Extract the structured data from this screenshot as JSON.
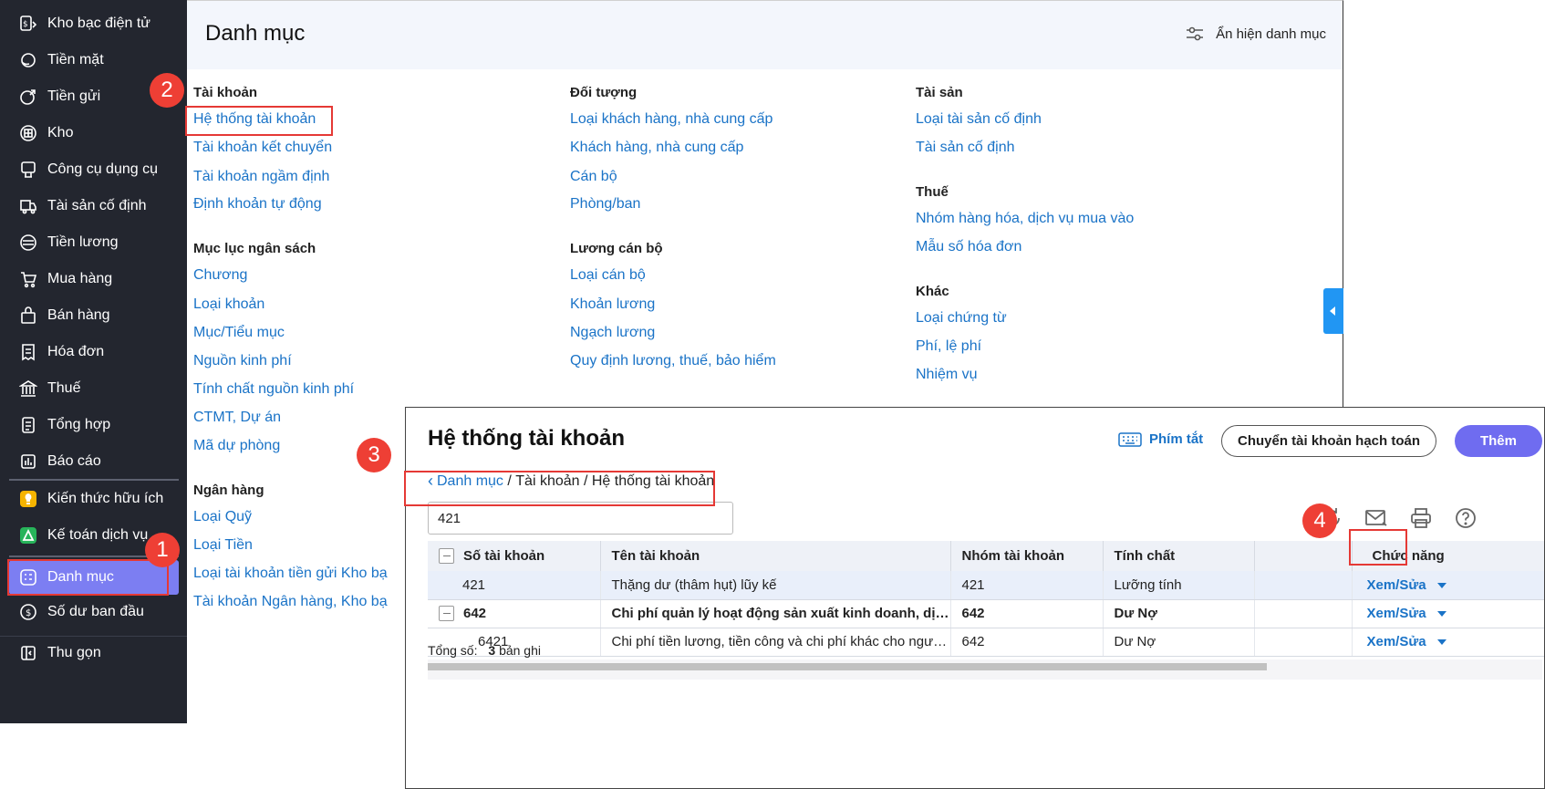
{
  "sidebar": {
    "items": [
      {
        "label": "Kho bạc điện tử",
        "icon": "treasury-icon"
      },
      {
        "label": "Tiền mặt",
        "icon": "cash-icon"
      },
      {
        "label": "Tiền gửi",
        "icon": "deposit-icon"
      },
      {
        "label": "Kho",
        "icon": "warehouse-icon"
      },
      {
        "label": "Công cụ dụng cụ",
        "icon": "tools-icon"
      },
      {
        "label": "Tài sản cố định",
        "icon": "truck-icon"
      },
      {
        "label": "Tiền lương",
        "icon": "salary-icon"
      },
      {
        "label": "Mua hàng",
        "icon": "cart-icon"
      },
      {
        "label": "Bán hàng",
        "icon": "sales-icon"
      },
      {
        "label": "Hóa đơn",
        "icon": "invoice-icon"
      },
      {
        "label": "Thuế",
        "icon": "tax-icon"
      },
      {
        "label": "Tổng hợp",
        "icon": "summary-icon"
      },
      {
        "label": "Báo cáo",
        "icon": "report-icon"
      }
    ],
    "extra": [
      {
        "label": "Kiến thức hữu ích",
        "icon": "lightbulb-icon"
      },
      {
        "label": "Kế toán dịch vụ",
        "icon": "service-icon"
      }
    ],
    "active": {
      "label": "Danh mục",
      "icon": "catalog-icon"
    },
    "opening": {
      "label": "Số dư ban đầu",
      "icon": "opening-balance-icon"
    },
    "collapse": {
      "label": "Thu gọn",
      "icon": "collapse-icon"
    }
  },
  "main": {
    "title": "Danh mục",
    "toggle_label": "Ẩn hiện danh mục",
    "col1": {
      "sections": [
        {
          "title": "Tài khoản",
          "links": [
            "Hệ thống tài khoản",
            "Tài khoản kết chuyển",
            "Tài khoản ngầm định",
            "Định khoản tự động"
          ]
        },
        {
          "title": "Mục lục ngân sách",
          "links": [
            "Chương",
            "Loại khoản",
            "Mục/Tiểu mục",
            "Nguồn kinh phí",
            "Tính chất nguồn kinh phí",
            "CTMT, Dự án",
            "Mã dự phòng"
          ]
        },
        {
          "title": "Ngân hàng",
          "links": [
            "Loại Quỹ",
            "Loại Tiền",
            "Loại tài khoản tiền gửi Kho bạ",
            "Tài khoản Ngân hàng, Kho bạ"
          ]
        }
      ]
    },
    "col2": {
      "sections": [
        {
          "title": "Đối tượng",
          "links": [
            "Loại khách hàng, nhà cung cấp",
            "Khách hàng, nhà cung cấp",
            "Cán bộ",
            "Phòng/ban"
          ]
        },
        {
          "title": "Lương cán bộ",
          "links": [
            "Loại cán bộ",
            "Khoản lương",
            "Ngạch lương",
            "Quy định lương, thuế, bảo hiểm"
          ]
        }
      ]
    },
    "col3": {
      "sections": [
        {
          "title": "Tài sản",
          "links": [
            "Loại tài sản cố định",
            "Tài sản cố định"
          ]
        },
        {
          "title": "Thuế",
          "links": [
            "Nhóm hàng hóa, dịch vụ mua vào",
            "Mẫu số hóa đơn"
          ]
        },
        {
          "title": "Khác",
          "links": [
            "Loại chứng từ",
            "Phí, lệ phí",
            "Nhiệm vụ"
          ]
        }
      ]
    }
  },
  "dialog": {
    "title": "Hệ thống tài khoản",
    "shortcut_label": "Phím tắt",
    "transfer_button": "Chuyển tài khoản hạch toán",
    "add_button": "Thêm",
    "breadcrumb": {
      "back": "Danh mục",
      "sep1": " / ",
      "mid": "Tài khoản",
      "sep2": " / ",
      "current": "Hệ thống tài khoản"
    },
    "search_value": "421",
    "columns": [
      "Số tài khoản",
      "Tên tài khoản",
      "Nhóm tài khoản",
      "Tính chất",
      "",
      "Chức năng"
    ],
    "rows": [
      {
        "code": "421",
        "name": "Thặng dư (thâm hụt) lũy kế",
        "group": "421",
        "nature": "Lưỡng tính",
        "action": "Xem/Sửa"
      },
      {
        "code": "642",
        "name": "Chi phí quản lý hoạt động sản xuất kinh doanh, dịch vụ",
        "group": "642",
        "nature": "Dư Nợ",
        "action": "Xem/Sửa"
      },
      {
        "code": "6421",
        "name": "Chi phí tiền lương, tiền công và chi phí khác cho người l...",
        "group": "642",
        "nature": "Dư Nợ",
        "action": "Xem/Sửa"
      }
    ],
    "total_label": "Tổng số:",
    "total_count": "3",
    "total_unit": "bản ghi"
  },
  "markers": [
    "1",
    "2",
    "3",
    "4"
  ],
  "colors": {
    "sidebar_bg": "#23262f",
    "active": "#7c7ef2",
    "link": "#1a73c7",
    "primary": "#6f6cf0",
    "annotation": "#e53935"
  }
}
